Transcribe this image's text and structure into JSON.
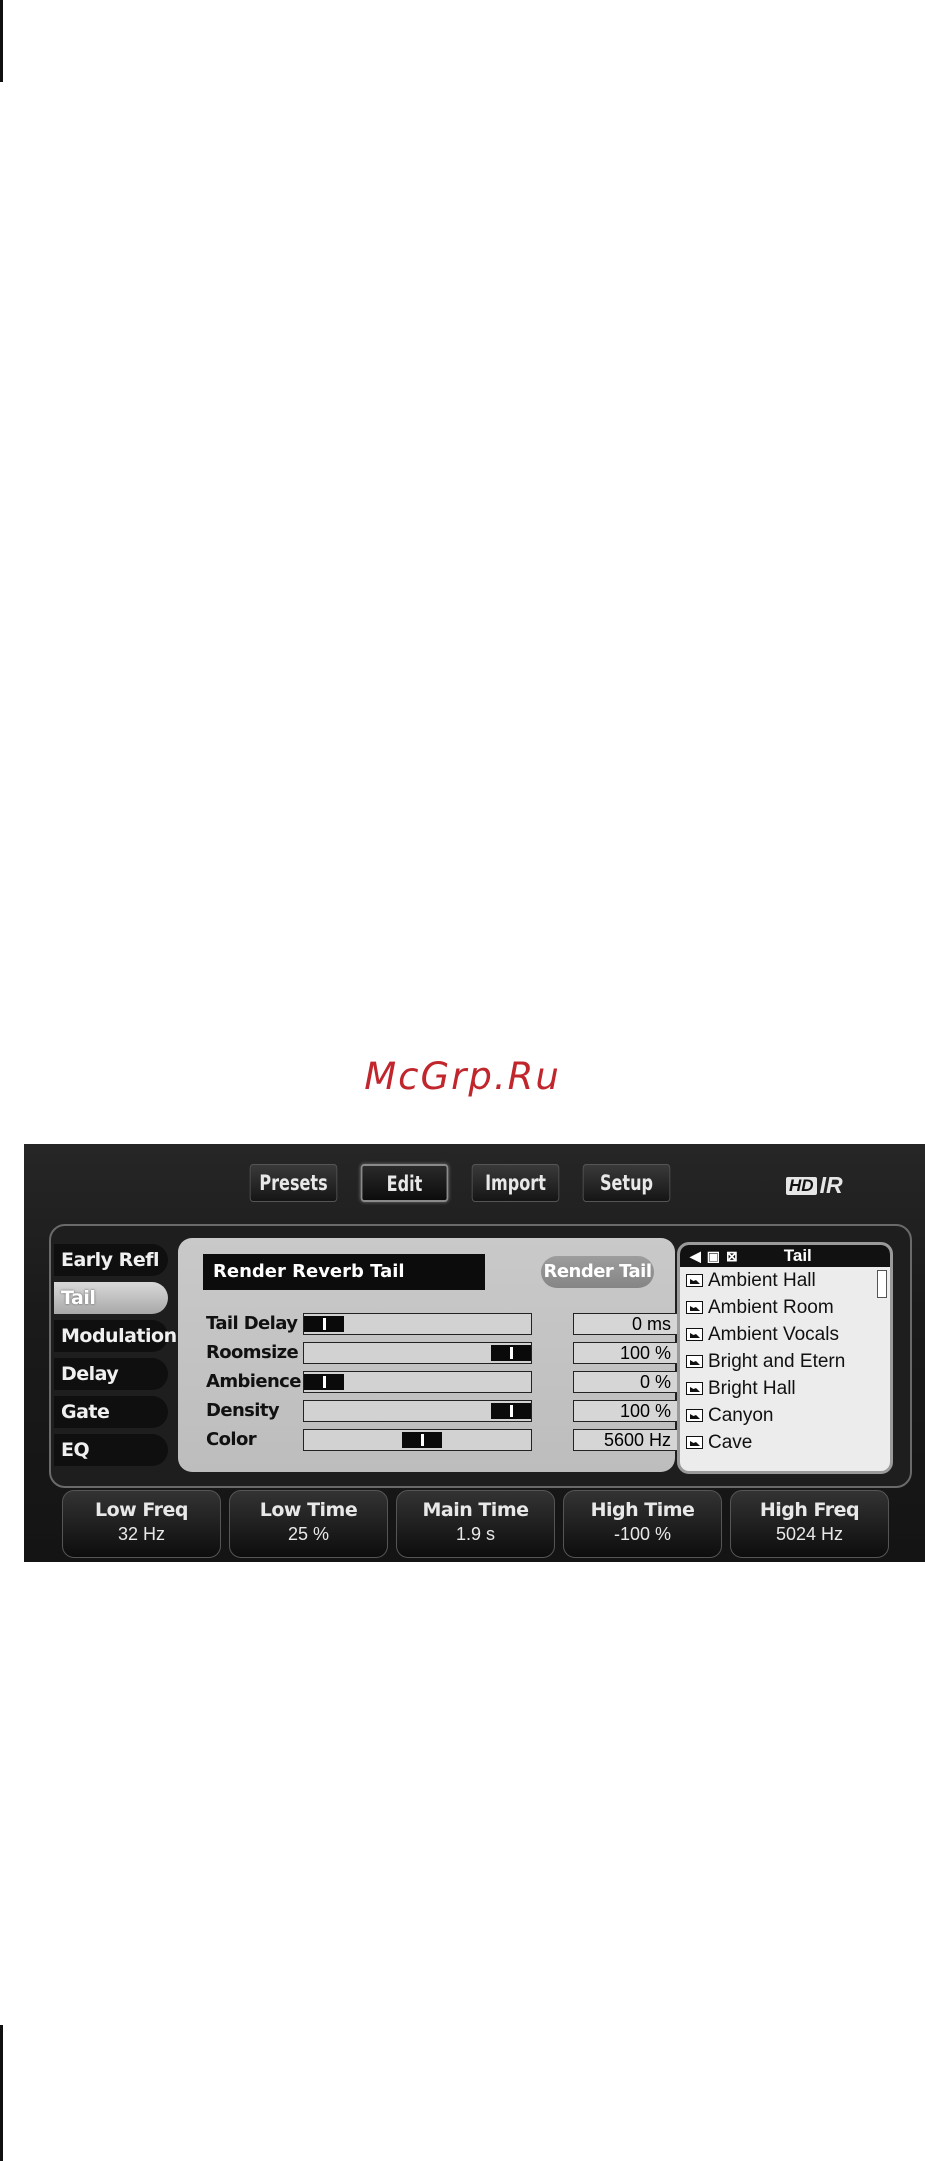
{
  "watermark": "McGrp.Ru",
  "tabs": [
    {
      "label": "Presets"
    },
    {
      "label": "Edit"
    },
    {
      "label": "Import"
    },
    {
      "label": "Setup"
    }
  ],
  "active_tab": "Edit",
  "logo": {
    "hd": "HD",
    "ir": "IR"
  },
  "sidebar": {
    "items": [
      {
        "label": "Early Refl"
      },
      {
        "label": "Tail"
      },
      {
        "label": "Modulation"
      },
      {
        "label": "Delay"
      },
      {
        "label": "Gate"
      },
      {
        "label": "EQ"
      }
    ],
    "active": "Tail"
  },
  "panel": {
    "render_label": "Render Reverb Tail",
    "render_button": "Render Tail",
    "params": [
      {
        "label": "Tail Delay",
        "value": "0 ms",
        "position": 0.09
      },
      {
        "label": "Roomsize",
        "value": "100 %",
        "position": 0.91
      },
      {
        "label": "Ambience",
        "value": "0 %",
        "position": 0.09
      },
      {
        "label": "Density",
        "value": "100 %",
        "position": 0.91
      },
      {
        "label": "Color",
        "value": "5600 Hz",
        "position": 0.52
      }
    ]
  },
  "preset_list": {
    "title": "Tail",
    "header_icons": [
      "speaker-icon",
      "save-icon",
      "delete-icon"
    ],
    "items": [
      {
        "label": "Ambient Hall"
      },
      {
        "label": "Ambient Room"
      },
      {
        "label": "Ambient Vocals"
      },
      {
        "label": "Bright and Etern"
      },
      {
        "label": "Bright Hall"
      },
      {
        "label": "Canyon"
      },
      {
        "label": "Cave"
      }
    ]
  },
  "knobs": [
    {
      "label": "Low Freq",
      "value": "32 Hz"
    },
    {
      "label": "Low Time",
      "value": "25 %"
    },
    {
      "label": "Main Time",
      "value": "1.9 s"
    },
    {
      "label": "High Time",
      "value": "-100 %"
    },
    {
      "label": "High Freq",
      "value": "5024 Hz"
    }
  ]
}
